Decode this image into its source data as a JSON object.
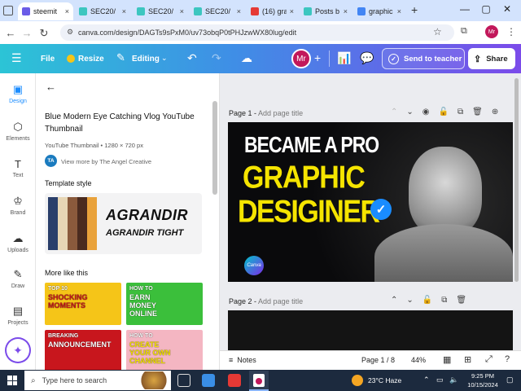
{
  "browser": {
    "tabs": [
      {
        "label": "steemit",
        "active": true,
        "color": "#6b5ce7"
      },
      {
        "label": "SEC20/",
        "color": "#3cc6c0"
      },
      {
        "label": "SEC20/",
        "color": "#3cc6c0"
      },
      {
        "label": "SEC20/",
        "color": "#3cc6c0"
      },
      {
        "label": "(16) gra",
        "color": "#e53935"
      },
      {
        "label": "Posts b",
        "color": "#3cc6c0"
      },
      {
        "label": "graphic",
        "color": "#4285f4"
      }
    ],
    "new_tab": "+",
    "url": "canva.com/design/DAGTs9sPxM0/uv73obqP0tPHJzwWX80lug/edit"
  },
  "canva_header": {
    "file": "File",
    "resize": "Resize",
    "editing": "Editing",
    "avatar": "Mr",
    "send_to_teacher": "Send to teacher",
    "share": "Share"
  },
  "rail": {
    "items": [
      {
        "label": "Design",
        "icon": "▣"
      },
      {
        "label": "Elements",
        "icon": "⬡"
      },
      {
        "label": "Text",
        "icon": "T"
      },
      {
        "label": "Brand",
        "icon": "♔"
      },
      {
        "label": "Uploads",
        "icon": "☁"
      },
      {
        "label": "Draw",
        "icon": "✎"
      },
      {
        "label": "Projects",
        "icon": "▤"
      }
    ]
  },
  "panel": {
    "title": "Blue Modern Eye Catching Vlog YouTube Thumbnail",
    "subtitle": "YouTube Thumbnail • 1280 × 720 px",
    "creator_initials": "TA",
    "creator_text": "View more by The Angel Creative",
    "template_style": "Template style",
    "font_name": "AGRANDIR",
    "font_tight": "AGRANDIR TIGHT",
    "palette": [
      "#2a3f6b",
      "#e7d6b5",
      "#8a5a3c",
      "#4a2b1f",
      "#e9a23b"
    ],
    "more_like_this": "More like this",
    "thumbs": [
      {
        "lines": [
          "TOP 10",
          "SHOCKING",
          "MOMENTS"
        ],
        "bg": "#f5c518"
      },
      {
        "lines": [
          "HOW TO",
          "EARN",
          "MONEY",
          "ONLINE"
        ],
        "bg": "#3bbf3b"
      },
      {
        "lines": [
          "BREAKING",
          "ANNOUNCEMENT"
        ],
        "bg": "#c8161d"
      },
      {
        "lines": [
          "HOW TO",
          "CREATE",
          "YOUR OWN",
          "CHANNEL"
        ],
        "bg": "#f4b6c2"
      }
    ]
  },
  "canvas": {
    "page1_label": "Page 1 -",
    "page1_add": "Add page title",
    "page2_label": "Page 2 -",
    "page2_add": "Add page title",
    "design_line1": "BECAME A PRO",
    "design_line2": "GRAPHIC",
    "design_line3": "DESIGINER",
    "design_logo": "Canva"
  },
  "bottom": {
    "notes": "Notes",
    "page_count": "Page 1 / 8",
    "zoom": "44%"
  },
  "taskbar": {
    "search_placeholder": "Type here to search",
    "weather": "23°C  Haze",
    "time": "9:25 PM",
    "date": "10/15/2024"
  },
  "colors": {
    "accent_yellow": "#f5e400",
    "check_blue": "#1a8cff"
  }
}
